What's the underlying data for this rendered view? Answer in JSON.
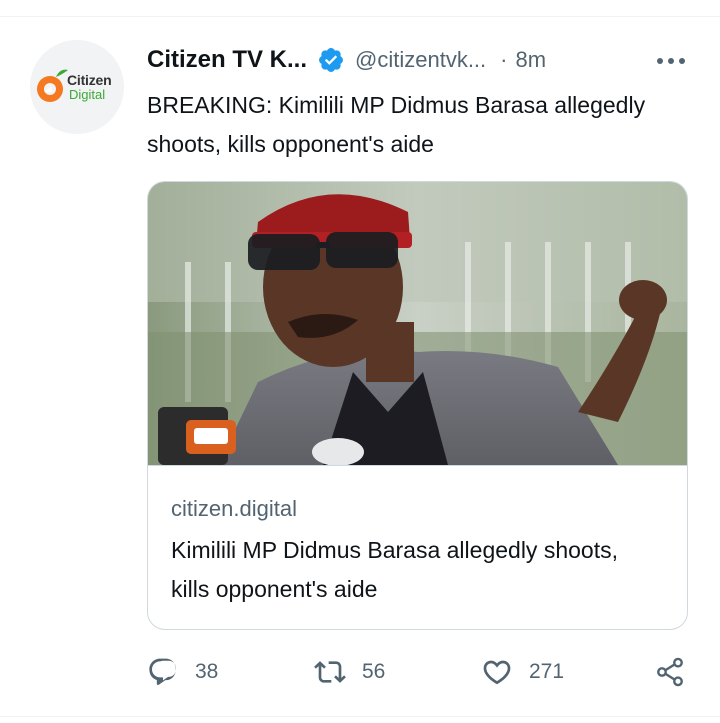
{
  "tweet": {
    "display_name": "Citizen TV K...",
    "handle": "@citizentvk...",
    "separator": "·",
    "time": "8m",
    "text": "BREAKING: Kimilili MP Didmus Barasa allegedly shoots, kills opponent's aide",
    "avatar": {
      "word1": "Citizen",
      "word2": "Digital"
    },
    "verified_color": "#1d9bf0"
  },
  "card": {
    "domain": "citizen.digital",
    "title": "Kimilili MP Didmus Barasa allegedly shoots, kills opponent's aide"
  },
  "actions": {
    "reply_count": "38",
    "retweet_count": "56",
    "like_count": "271"
  },
  "icons": [
    "more-icon",
    "verified-icon",
    "reply-icon",
    "retweet-icon",
    "like-icon",
    "share-icon"
  ]
}
